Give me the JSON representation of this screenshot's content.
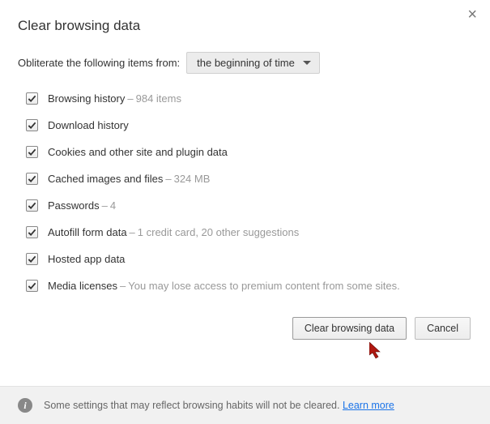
{
  "title": "Clear browsing data",
  "from_label": "Obliterate the following items from:",
  "time_range": "the beginning of time",
  "items": [
    {
      "label": "Browsing history",
      "hint": "984 items",
      "checked": true
    },
    {
      "label": "Download history",
      "hint": "",
      "checked": true
    },
    {
      "label": "Cookies and other site and plugin data",
      "hint": "",
      "checked": true
    },
    {
      "label": "Cached images and files",
      "hint": "324 MB",
      "checked": true
    },
    {
      "label": "Passwords",
      "hint": "4",
      "checked": true
    },
    {
      "label": "Autofill form data",
      "hint": "1 credit card, 20 other suggestions",
      "checked": true
    },
    {
      "label": "Hosted app data",
      "hint": "",
      "checked": true
    },
    {
      "label": "Media licenses",
      "hint": "You may lose access to premium content from some sites.",
      "checked": true
    }
  ],
  "buttons": {
    "clear": "Clear browsing data",
    "cancel": "Cancel"
  },
  "footer": {
    "text": "Some settings that may reflect browsing habits will not be cleared. ",
    "link": "Learn more"
  }
}
